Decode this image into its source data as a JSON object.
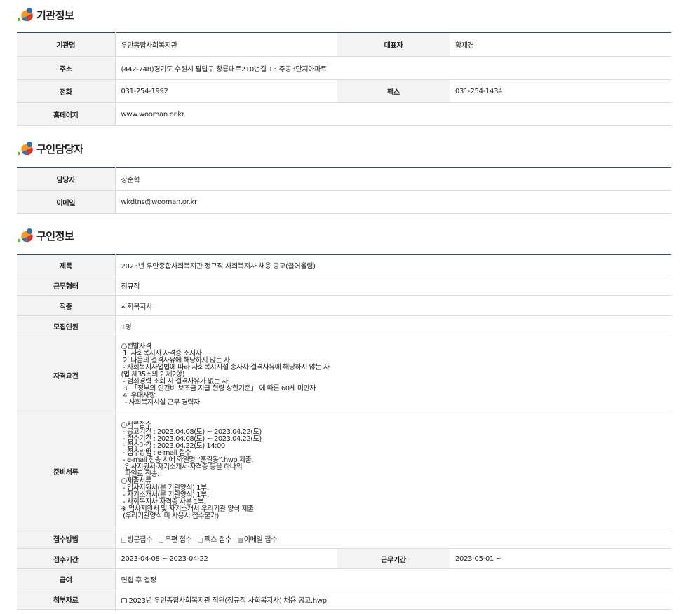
{
  "sections": {
    "org": "기관정보",
    "contact": "구인담당자",
    "job": "구인정보"
  },
  "org": {
    "name_label": "기관명",
    "name": "우만종합사회복지관",
    "rep_label": "대표자",
    "rep": "황재경",
    "addr_label": "주소",
    "addr": "(442-748)경기도 수원시 팔달구 창룡대로210번길 13 주공3단지아파트",
    "tel_label": "전화",
    "tel": "031-254-1992",
    "fax_label": "팩스",
    "fax": "031-254-1434",
    "home_label": "홈페이지",
    "home": "www.wooman.or.kr"
  },
  "contact": {
    "person_label": "담당자",
    "person": "장순혁",
    "email_label": "이메일",
    "email": "wkdtns@wooman.or.kr"
  },
  "job": {
    "title_label": "제목",
    "title": "2023년 우만종합사회복지관 정규직 사회복지사 채용 공고(끌어올림)",
    "type_label": "근무형태",
    "type": "정규직",
    "occ_label": "직종",
    "occ": "사회복지사",
    "count_label": "모집인원",
    "count": "1명",
    "qual_label": "자격요건",
    "qual": "○선발자격\n 1. 사회복지사 자격증 소지자\n 2. 다음의 결격사유에 해당하지 않는 자\n - 사회복지사업법에 따라 사회복지시설 종사자 결격사유에 해당하지 않는 자\n(법 제35조의 2 제2항)\n - 범죄경력 조회 시 결격사유가 없는 자\n 3. 「정부의 인건비 보조금 지급 현령 상한기준」 에 따른 60세 미만자\n 4. 우대사항\n  - 사회복지시설 근무 경력자",
    "docs_label": "준비서류",
    "docs": "○서류접수\n - 공고기간 : 2023.04.08(토) ~ 2023.04.22(토)\n - 접수기간 : 2023.04.08(토) ~ 2023.04.22(토)\n - 접수마감 : 2023.04.22(토) 14:00\n - 접수방법 : e-mail 접수\n - e-mail 전송 시에 화일명 “홍길동”.hwp 제출.\n  입사지원서·자기소개서·자격증 등을 하나의\n  파일로 전송.\n○제출서류\n - 입사지원서(본 기관양식) 1부.\n - 자기소개서(본 기관양식) 1부.\n - 사회복지사 자격증 사본 1부.\n※ 입사지원서 및 자기소개서 우리기관 양식 제출\n (우리기관양식 미 사용시 접수불가)",
    "method_label": "접수방법",
    "methods": [
      {
        "label": "방문접수",
        "checked": false
      },
      {
        "label": "우편 접수",
        "checked": false
      },
      {
        "label": "팩스 접수",
        "checked": false
      },
      {
        "label": "이메일 접수",
        "checked": true
      }
    ],
    "period_label": "접수기간",
    "period": "2023-04-08 ~ 2023-04-22",
    "work_label": "근무기간",
    "work": "2023-05-01 ~",
    "pay_label": "급여",
    "pay": "면접 후 결정",
    "attach_label": "첨부자료",
    "attach": "2023년 우만종합사회복지관 직원(정규직 사회복지사) 채용 공고.hwp"
  },
  "colors": {
    "logo_blue": "#2f6fb3",
    "logo_orange": "#f39a1e",
    "logo_red": "#d9352a",
    "logo_green": "#6ab23e",
    "header_line": "#2e4a6b"
  }
}
